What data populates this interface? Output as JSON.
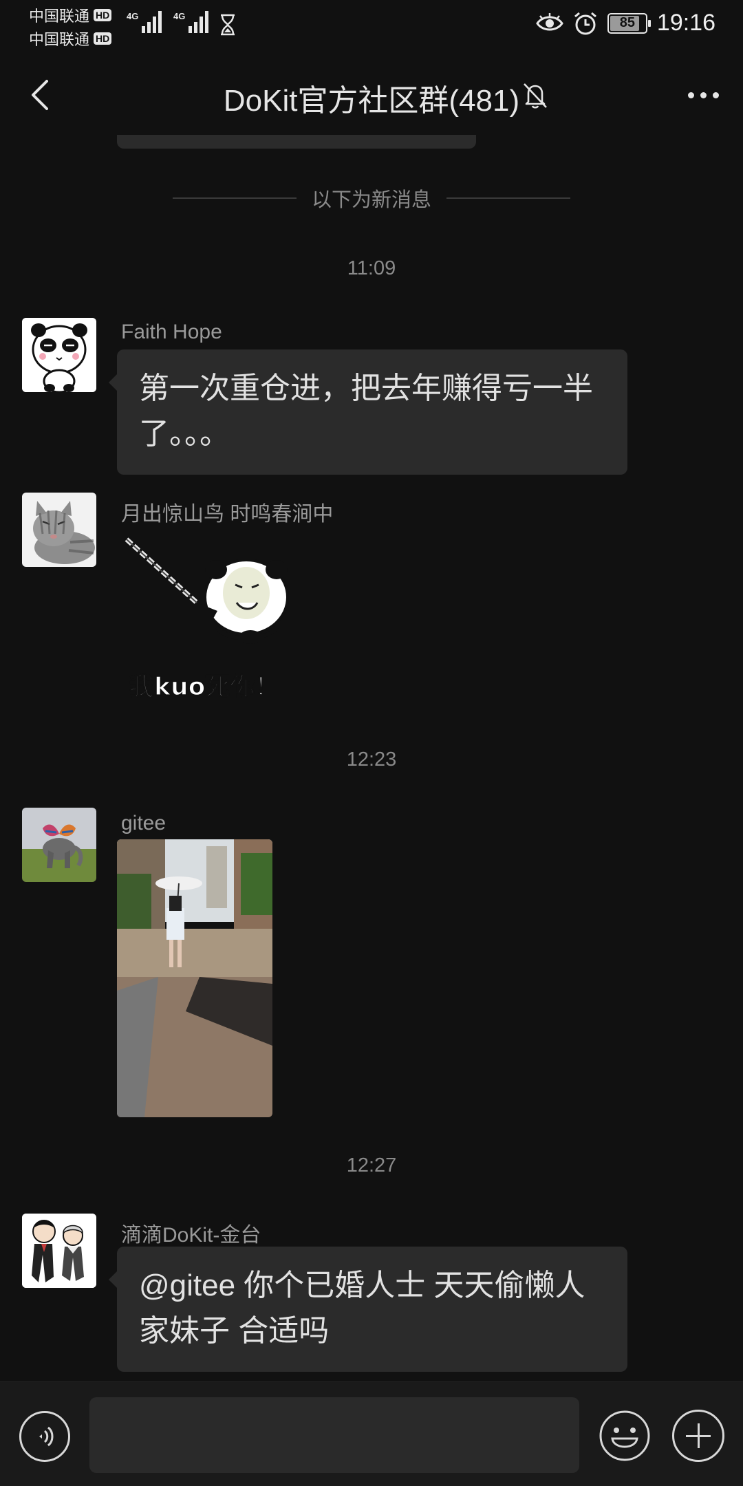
{
  "status_bar": {
    "carrier_1": "中国联通",
    "carrier_2": "中国联通",
    "hd_badge": "HD",
    "network_type": "4G",
    "battery_level": "85",
    "battery_fraction": 0.85,
    "time": "19:16",
    "icons": [
      "eye-icon",
      "alarm-icon",
      "hourglass-icon"
    ]
  },
  "header": {
    "title": "DoKit官方社区群(481)",
    "icons": [
      "back-arrow-icon",
      "mute-bell-icon",
      "more-dots-icon"
    ]
  },
  "chat": {
    "new_messages_divider": "以下为新消息",
    "timestamps": [
      "11:09",
      "12:23",
      "12:27"
    ],
    "messages": [
      {
        "sender": "Faith Hope",
        "type": "text",
        "lines": [
          "第一次重仓进，把去年赚得亏一半",
          "了。。。"
        ]
      },
      {
        "sender": "月出惊山鸟  时鸣春涧中",
        "type": "sticker",
        "sticker_text": "我kuo死你！"
      },
      {
        "sender": "gitee",
        "type": "image"
      },
      {
        "sender": "滴滴DoKit-金台",
        "type": "text",
        "lines": [
          "@gitee  你个已婚人士 天天偷懒人",
          "家妹子 合适吗"
        ]
      }
    ]
  },
  "input_bar": {
    "value": "",
    "icons": [
      "voice-icon",
      "emoji-icon",
      "plus-icon"
    ]
  },
  "colors": {
    "background": "#111111",
    "bubble": "#2b2b2b",
    "text": "#e2e2e2",
    "muted": "#8a8a8a"
  }
}
